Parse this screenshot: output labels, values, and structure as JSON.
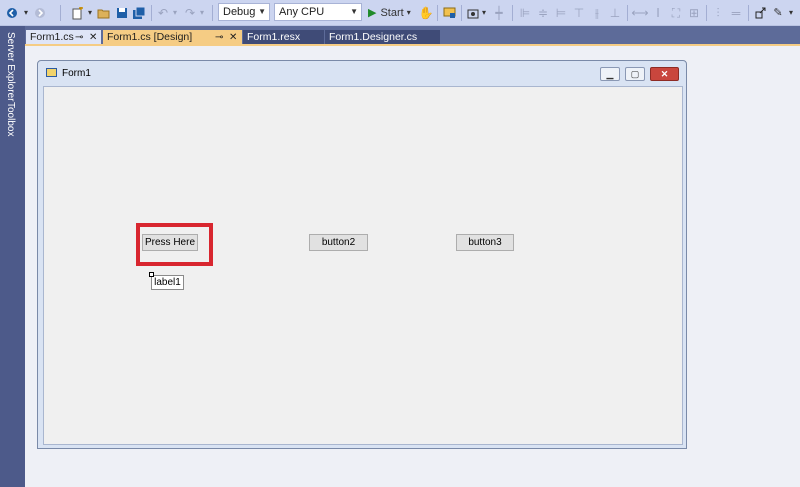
{
  "toolbar": {
    "config_combo": "Debug",
    "platform_combo": "Any CPU",
    "start_label": "Start",
    "icons": [
      "back-icon",
      "forward-icon",
      "new-project-icon",
      "open-folder-icon",
      "save-icon",
      "save-all-icon",
      "undo-icon",
      "redo-icon",
      "start-icon",
      "attach-icon",
      "find-icon",
      "screenshot-icon",
      "align-icons",
      "pin-icon"
    ]
  },
  "sidebar": {
    "server_explorer": "Server Explorer",
    "toolbox": "Toolbox"
  },
  "tabs": [
    {
      "label": "Form1.cs",
      "active": false
    },
    {
      "label": "Form1.cs [Design]",
      "active": true
    },
    {
      "label": "Form1.resx",
      "active": false
    },
    {
      "label": "Form1.Designer.cs",
      "active": false
    }
  ],
  "form": {
    "title": "Form1",
    "button1": "Press Here",
    "button2": "button2",
    "button3": "button3",
    "label1": "label1"
  },
  "colors": {
    "highlight": "#d8262f",
    "active_tab": "#f5cc84",
    "chrome": "#5d6b99"
  }
}
